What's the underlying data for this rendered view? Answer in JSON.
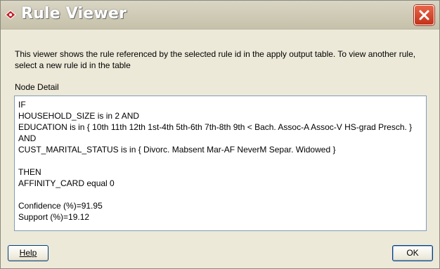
{
  "window": {
    "title": "Rule Viewer"
  },
  "description": "This viewer shows the rule referenced by the selected rule id in the apply output table.  To view another rule, select a new rule id in the table",
  "node_detail": {
    "label": "Node Detail",
    "lines": [
      "IF",
      "HOUSEHOLD_SIZE is in 2 AND",
      "EDUCATION is in { 10th 11th 12th 1st-4th 5th-6th 7th-8th 9th < Bach. Assoc-A Assoc-V HS-grad Presch. }",
      "AND",
      "CUST_MARITAL_STATUS is in { Divorc. Mabsent Mar-AF NeverM Separ. Widowed }",
      "",
      "THEN",
      "AFFINITY_CARD equal 0",
      "",
      "Confidence (%)=91.95",
      "Support (%)=19.12"
    ]
  },
  "buttons": {
    "help": "Help",
    "ok": "OK"
  },
  "icons": {
    "app": "oracle-diamond-icon",
    "close": "close-icon"
  },
  "colors": {
    "close_button": "#c2331a",
    "detail_border": "#7f9db9",
    "window_bg": "#ece9d8"
  }
}
